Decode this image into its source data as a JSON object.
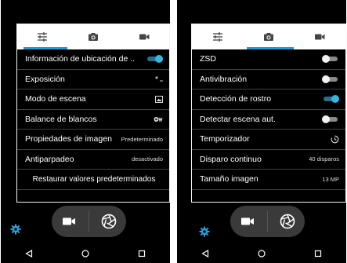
{
  "screens": [
    {
      "settings": [
        {
          "label": "Información de ubicación de ..",
          "toggle": "on"
        },
        {
          "label": "Exposición",
          "icon": "exposure-icon"
        },
        {
          "label": "Modo de escena",
          "icon": "scene-mode-icon"
        },
        {
          "label": "Balance de blancos",
          "icon": "white-balance-icon"
        },
        {
          "label": "Propiedades de imagen",
          "value": "Predeterminado"
        },
        {
          "label": "Antiparpadeo",
          "value": "desactivado"
        },
        {
          "label": "Restaurar valores predeterminados"
        }
      ]
    },
    {
      "settings": [
        {
          "label": "ZSD",
          "toggle": "off"
        },
        {
          "label": "Antivibración",
          "toggle": "off"
        },
        {
          "label": "Detección de rostro",
          "toggle": "on"
        },
        {
          "label": "Detectar escena aut.",
          "toggle": "off"
        },
        {
          "label": "Temporizador",
          "icon": "timer-icon"
        },
        {
          "label": "Disparo continuo",
          "value": "40 disparos"
        },
        {
          "label": "Tamaño imagen",
          "value": "13 MP"
        }
      ]
    }
  ],
  "tabs": [
    {
      "icon": "adjustments-icon"
    },
    {
      "icon": "camera-icon"
    },
    {
      "icon": "video-camera-icon"
    }
  ],
  "colors": {
    "accent": "#1e9ad6",
    "toggle_on": "#39b4e0",
    "gear": "#2b9fd9"
  }
}
